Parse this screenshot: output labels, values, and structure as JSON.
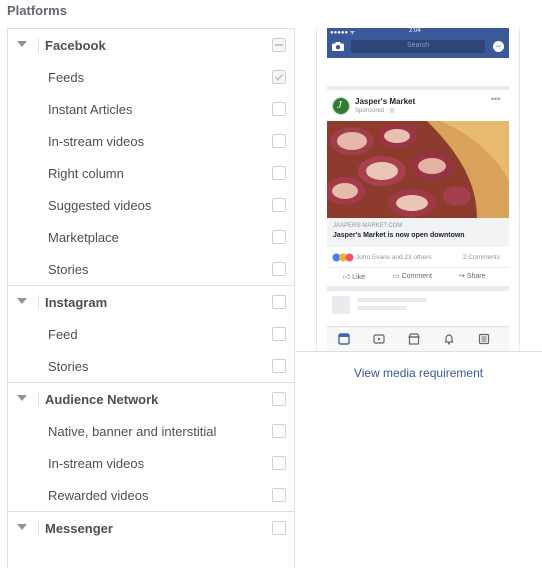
{
  "section_title": "Platforms",
  "groups": [
    {
      "name": "Facebook",
      "state": "mixed",
      "items": [
        {
          "label": "Feeds",
          "state": "checked"
        },
        {
          "label": "Instant Articles",
          "state": "unchecked"
        },
        {
          "label": "In-stream videos",
          "state": "unchecked"
        },
        {
          "label": "Right column",
          "state": "unchecked"
        },
        {
          "label": "Suggested videos",
          "state": "unchecked"
        },
        {
          "label": "Marketplace",
          "state": "unchecked"
        },
        {
          "label": "Stories",
          "state": "unchecked"
        }
      ]
    },
    {
      "name": "Instagram",
      "state": "unchecked",
      "items": [
        {
          "label": "Feed",
          "state": "unchecked"
        },
        {
          "label": "Stories",
          "state": "unchecked"
        }
      ]
    },
    {
      "name": "Audience Network",
      "state": "unchecked",
      "items": [
        {
          "label": "Native, banner and interstitial",
          "state": "unchecked"
        },
        {
          "label": "In-stream videos",
          "state": "unchecked"
        },
        {
          "label": "Rewarded videos",
          "state": "unchecked"
        }
      ]
    },
    {
      "name": "Messenger",
      "state": "unchecked",
      "items": []
    }
  ],
  "preview": {
    "status_time": "2:04",
    "status_signal": "●●●●● ᯤ",
    "search_placeholder": "Search",
    "page_name": "Jasper's Market",
    "sponsored": "Sponsored · ◎",
    "avatar_letter": "J",
    "link_url": "JASPERS-MARKET.COM",
    "link_title": "Jasper's Market is now open downtown",
    "reactions_text": "John Evans and 23 others",
    "comments_text": "2 Comments",
    "like_label": "Like",
    "comment_label": "Comment",
    "share_label": "Share",
    "brand_color": "#3b5998"
  },
  "view_media_link": "View media requirement"
}
